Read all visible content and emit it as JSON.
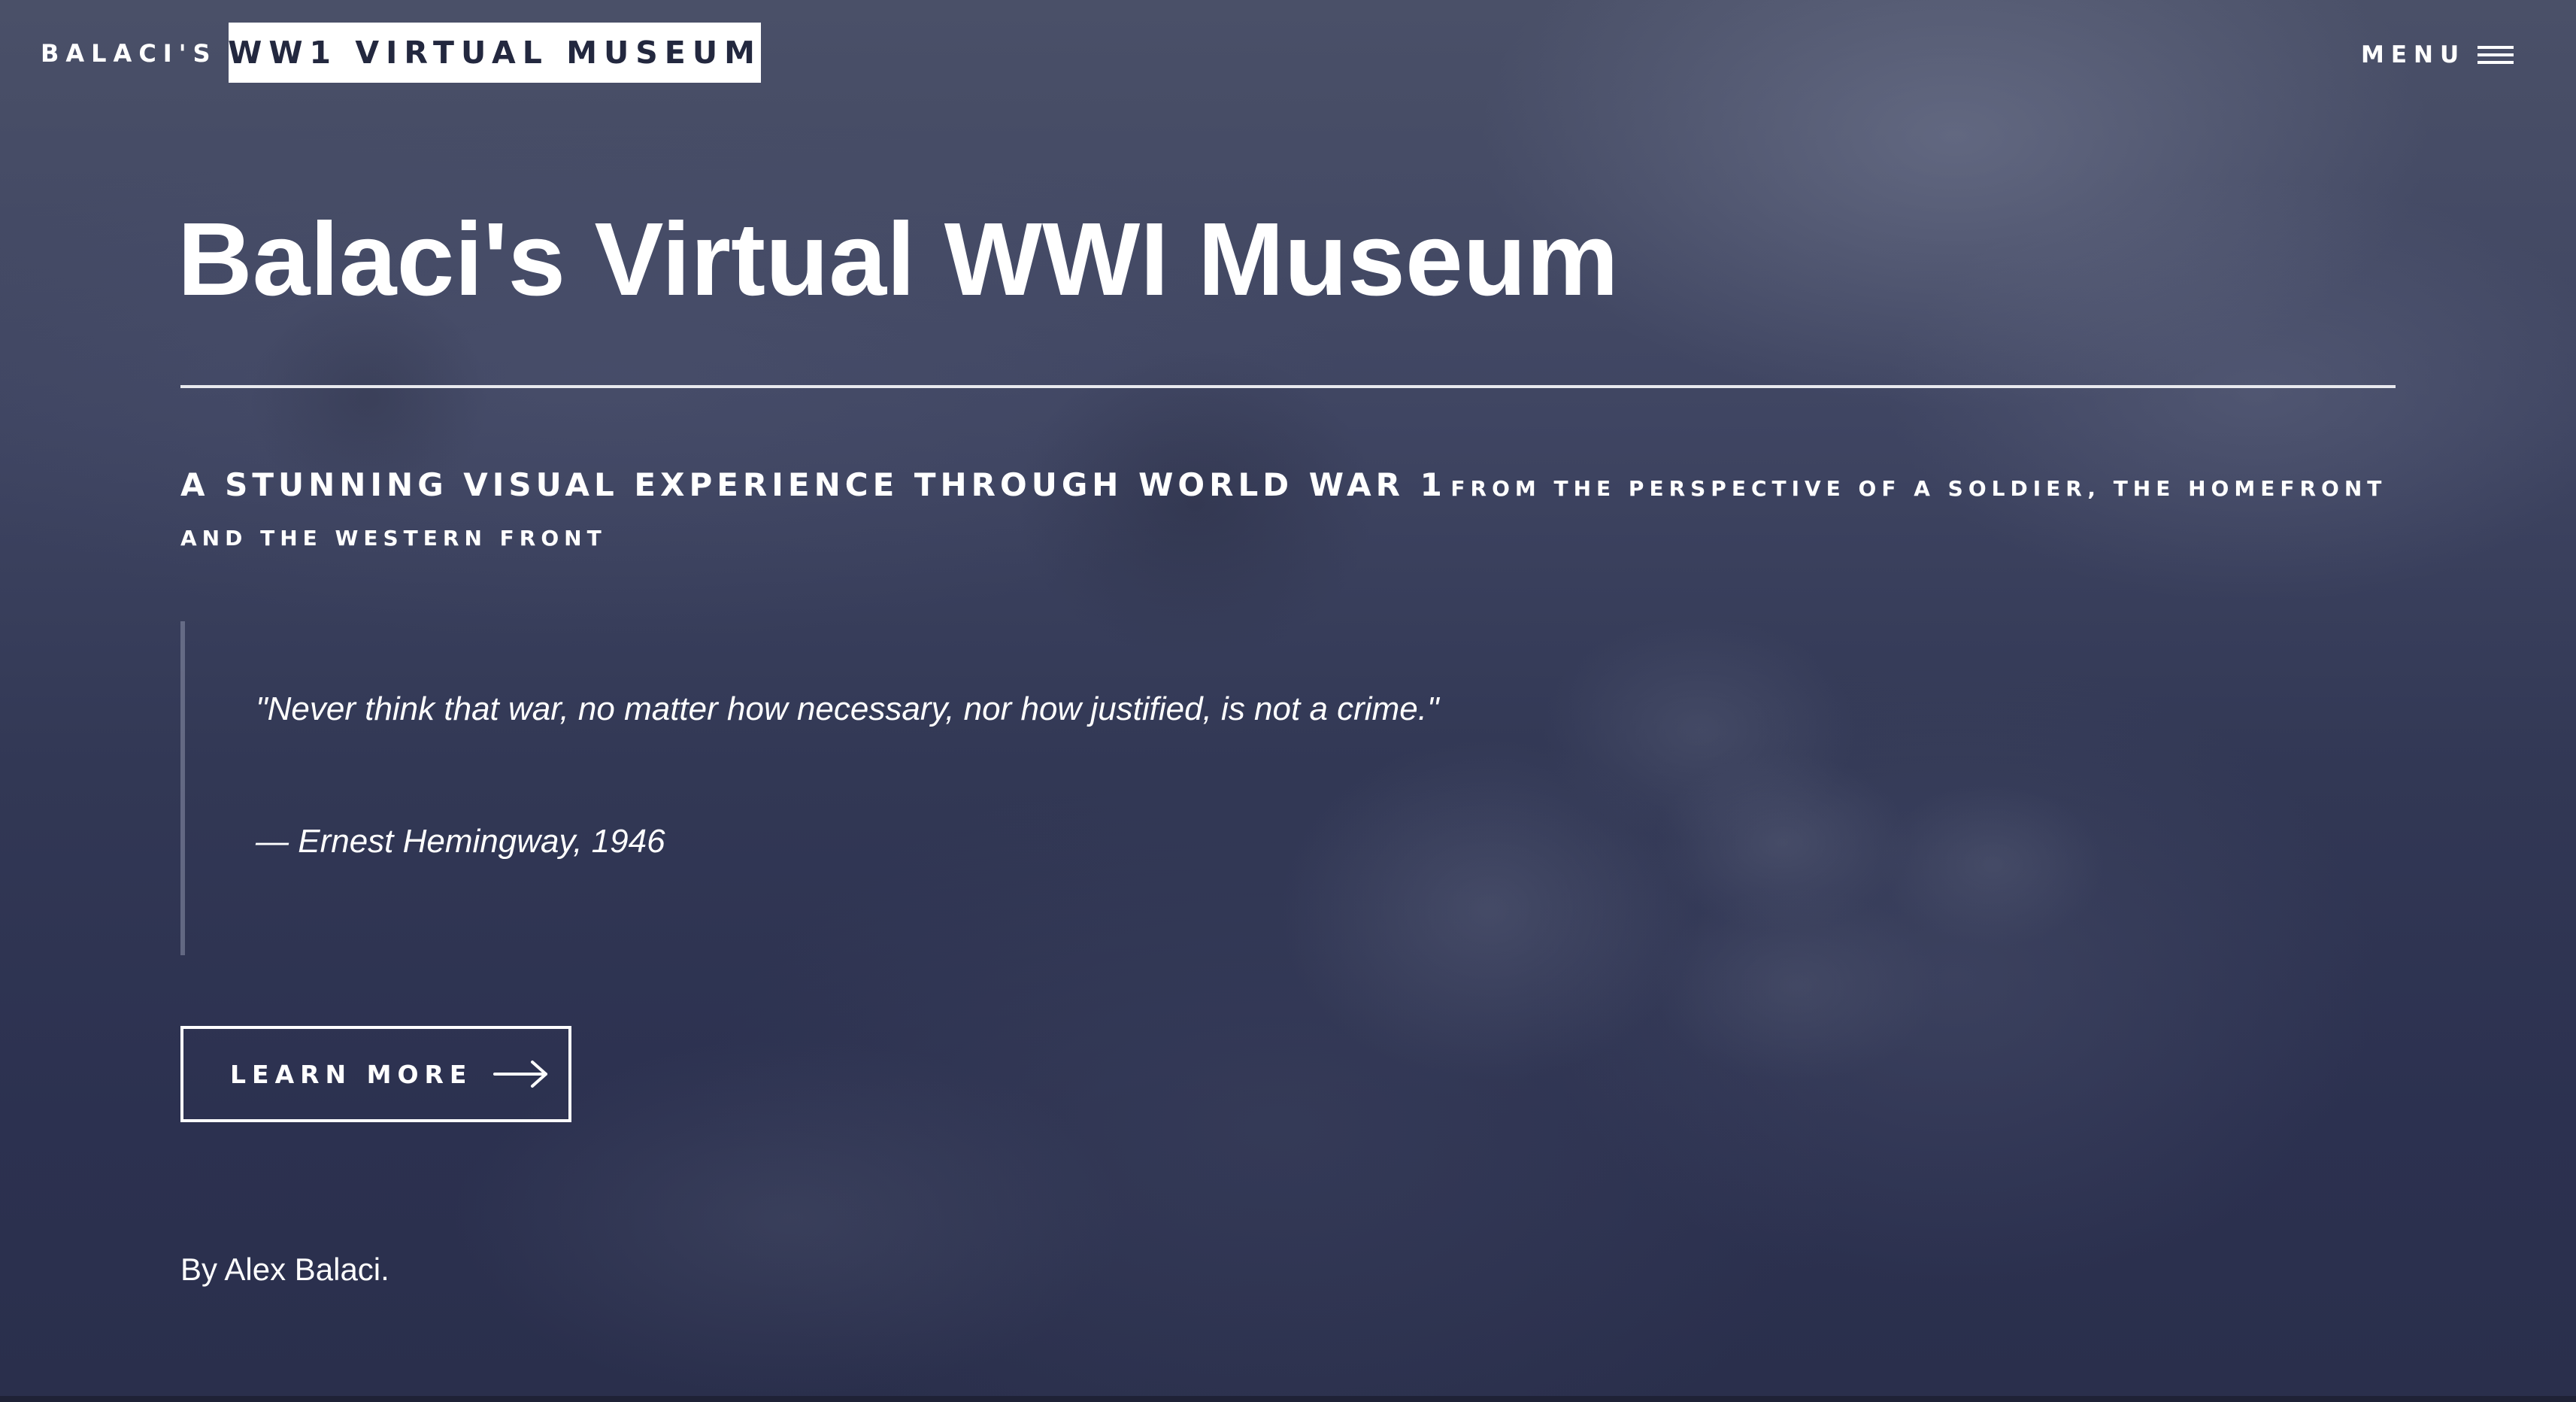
{
  "header": {
    "brand_prefix": "BALACI'S",
    "brand_name": "WW1 VIRTUAL MUSEUM",
    "menu_label": "MENU",
    "menu_icon": "hamburger-icon"
  },
  "hero": {
    "title": "Balaci's Virtual WWI Museum",
    "subtitle_main": "A STUNNING VISUAL EXPERIENCE THROUGH WORLD WAR 1",
    "subtitle_rest": "FROM THE PERSPECTIVE OF A SOLDIER, THE HOMEFRONT AND THE WESTERN FRONT",
    "quote": "\"Never think that war, no matter how necessary, nor how justified, is not a crime.\"",
    "quote_attribution": "— Ernest Hemingway, 1946",
    "cta_label": "LEARN MORE",
    "cta_icon": "arrow-right-icon",
    "byline": "By Alex Balaci."
  },
  "colors": {
    "overlay": "#323855",
    "text": "#ffffff",
    "brand_box_text": "#23283f"
  }
}
